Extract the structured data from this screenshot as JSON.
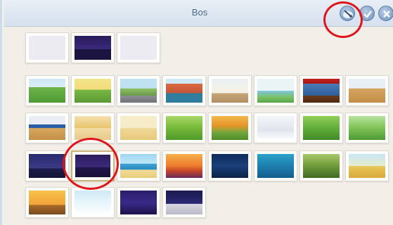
{
  "window": {
    "title": "Bos",
    "buttons": [
      {
        "name": "paint-new-backdrop-icon"
      },
      {
        "name": "confirm-icon"
      },
      {
        "name": "close-icon"
      }
    ]
  },
  "backdrops": [
    {
      "row": 0,
      "theme": "blank"
    },
    {
      "row": 0,
      "theme": "night-city"
    },
    {
      "row": 0,
      "theme": "blank"
    },
    {
      "row": 1,
      "theme": "meadow"
    },
    {
      "row": 1,
      "theme": "park-city"
    },
    {
      "row": 1,
      "theme": "town"
    },
    {
      "row": 1,
      "theme": "buildings"
    },
    {
      "row": 1,
      "theme": "classroom"
    },
    {
      "row": 1,
      "theme": "playground"
    },
    {
      "row": 1,
      "theme": "stage"
    },
    {
      "row": 1,
      "theme": "gym"
    },
    {
      "row": 2,
      "theme": "basketball"
    },
    {
      "row": 2,
      "theme": "room"
    },
    {
      "row": 2,
      "theme": "bedroom"
    },
    {
      "row": 2,
      "theme": "forest"
    },
    {
      "row": 2,
      "theme": "autumn"
    },
    {
      "row": 2,
      "theme": "winter"
    },
    {
      "row": 2,
      "theme": "forest2"
    },
    {
      "row": 2,
      "theme": "field"
    },
    {
      "row": 3,
      "theme": "night-hills"
    },
    {
      "row": 3,
      "theme": "night-city-selected"
    },
    {
      "row": 3,
      "theme": "beach"
    },
    {
      "row": 3,
      "theme": "sunset-sea"
    },
    {
      "row": 3,
      "theme": "night-sea"
    },
    {
      "row": 3,
      "theme": "underwater"
    },
    {
      "row": 3,
      "theme": "jungle"
    },
    {
      "row": 3,
      "theme": "savanna"
    },
    {
      "row": 4,
      "theme": "desert-sunset"
    },
    {
      "row": 4,
      "theme": "arctic"
    },
    {
      "row": 4,
      "theme": "space"
    },
    {
      "row": 4,
      "theme": "moon"
    }
  ],
  "colors": {
    "highlight": "#e0141a"
  }
}
